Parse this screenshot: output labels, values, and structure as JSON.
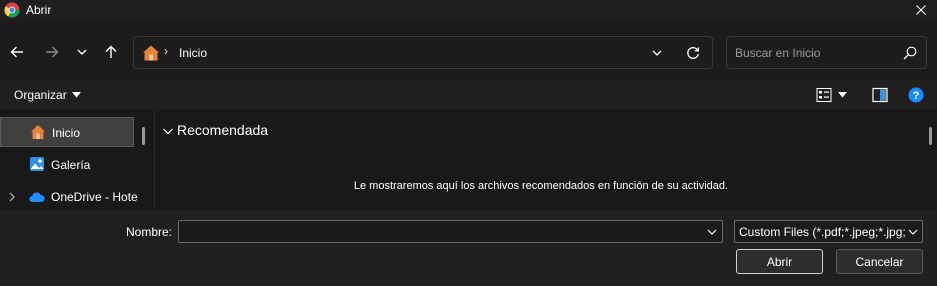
{
  "window": {
    "title": "Abrir",
    "icon": "chrome-icon"
  },
  "address_bar": {
    "home_icon": "home-icon",
    "separator": "›",
    "path": "Inicio"
  },
  "search": {
    "placeholder": "Buscar en Inicio"
  },
  "toolbar": {
    "organize_label": "Organizar"
  },
  "sidebar": {
    "items": [
      {
        "label": "Inicio",
        "icon": "home-icon",
        "selected": true
      },
      {
        "label": "Galería",
        "icon": "gallery-icon",
        "selected": false
      },
      {
        "label": "OneDrive - Hote",
        "icon": "onedrive-icon",
        "selected": false,
        "expandable": true
      }
    ]
  },
  "main": {
    "group_title": "Recomendada",
    "empty_message": "Le mostraremos aquí los archivos recomendados en función de su actividad."
  },
  "bottom": {
    "name_label": "Nombre:",
    "name_value": "",
    "filter_value": "Custom Files (*.pdf;*.jpeg;*.jpg;",
    "open_label": "Abrir",
    "cancel_label": "Cancelar"
  },
  "colors": {
    "background": "#191919",
    "panel": "#202020",
    "accent_blue": "#1a8cff",
    "home_orange": "#e8813a"
  }
}
